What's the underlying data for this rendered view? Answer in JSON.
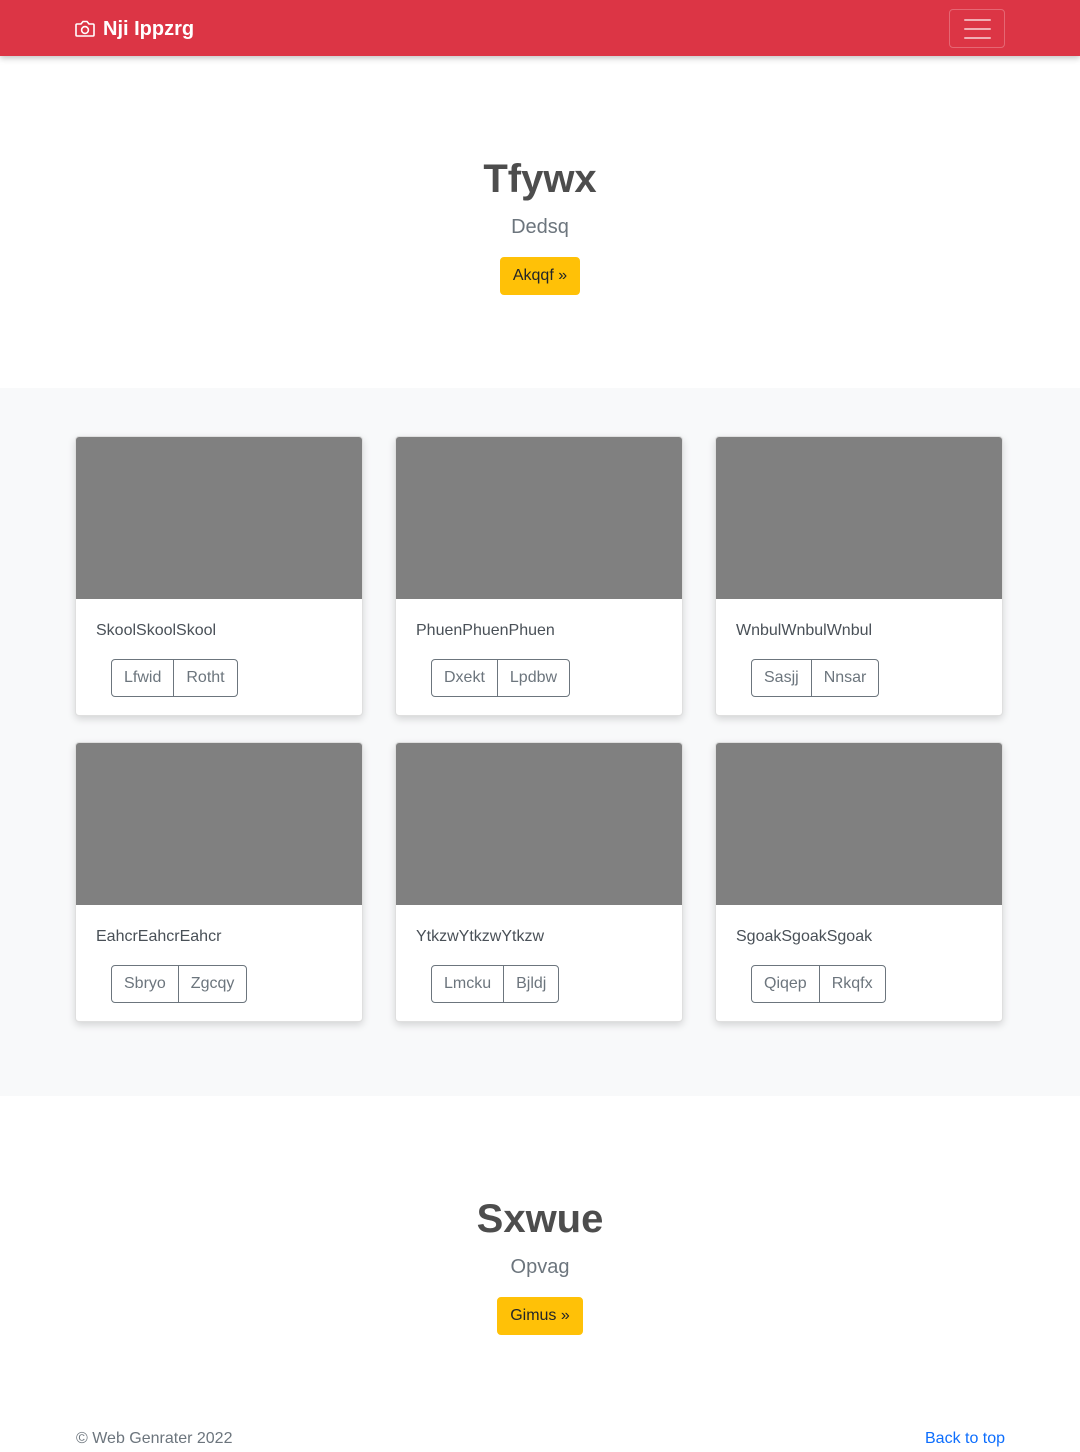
{
  "navbar": {
    "brand": "Nji Ippzrg",
    "brand_icon": "camera-icon",
    "color": "#dc3545"
  },
  "hero1": {
    "title": "Tfywx",
    "subtitle": "Dedsq",
    "button": "Akqqf »"
  },
  "cards": [
    {
      "text": "SkoolSkoolSkool",
      "buttons": [
        "Lfwid",
        "Rotht"
      ]
    },
    {
      "text": "PhuenPhuenPhuen",
      "buttons": [
        "Dxekt",
        "Lpdbw"
      ]
    },
    {
      "text": "WnbulWnbulWnbul",
      "buttons": [
        "Sasjj",
        "Nnsar"
      ]
    },
    {
      "text": "EahcrEahcrEahcr",
      "buttons": [
        "Sbryo",
        "Zgcqy"
      ]
    },
    {
      "text": "YtkzwYtkzwYtkzw",
      "buttons": [
        "Lmcku",
        "Bjldj"
      ]
    },
    {
      "text": "SgoakSgoakSgoak",
      "buttons": [
        "Qiqep",
        "Rkqfx"
      ]
    }
  ],
  "hero2": {
    "title": "Sxwue",
    "subtitle": "Opvag",
    "button": "Gimus »"
  },
  "footer": {
    "copyright": "© Web Genrater 2022",
    "back_to_top": "Back to top"
  }
}
